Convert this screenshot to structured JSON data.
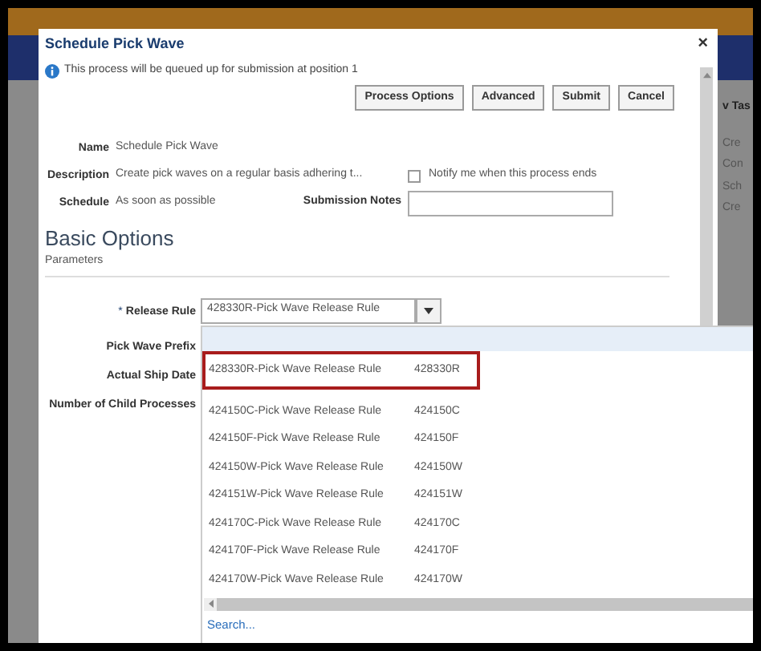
{
  "page_behind": {
    "panel_title": "v Tas",
    "links": [
      "Cre",
      "Con",
      "Sch",
      "Cre"
    ]
  },
  "dialog": {
    "title": "Schedule Pick Wave",
    "close": "×",
    "info": "This process will be queued up for submission at position 1",
    "buttons": [
      "Process Options",
      "Advanced",
      "Submit",
      "Cancel"
    ],
    "name": {
      "label": "Name",
      "value": "Schedule Pick Wave"
    },
    "description": {
      "label": "Description",
      "value": "Create pick waves on a regular basis adhering t..."
    },
    "notify": {
      "label": "Notify me when this process ends",
      "checked": false
    },
    "schedule": {
      "label": "Schedule",
      "value": "As soon as possible"
    },
    "submission_notes": {
      "label": "Submission Notes"
    },
    "section_title": "Basic Options",
    "subsection": "Parameters",
    "parameters": [
      {
        "label": "Release Rule",
        "required_mark": "*",
        "value": "428330R-Pick Wave Release Rule"
      },
      {
        "label": "Pick Wave Prefix"
      },
      {
        "label": "Actual Ship Date"
      },
      {
        "label": "Number of Child Processes"
      }
    ],
    "dropdown": {
      "blank_row_highlighted": true,
      "options": [
        {
          "name": "428330R-Pick Wave Release Rule",
          "code": "428330R",
          "selected": true
        },
        {
          "name": "424150C-Pick Wave Release Rule",
          "code": "424150C",
          "selected": false
        },
        {
          "name": "424150F-Pick Wave Release Rule",
          "code": "424150F",
          "selected": false
        },
        {
          "name": "424150W-Pick Wave Release Rule",
          "code": "424150W",
          "selected": false
        },
        {
          "name": "424151W-Pick Wave Release Rule",
          "code": "424151W",
          "selected": false
        },
        {
          "name": "424170C-Pick Wave Release Rule",
          "code": "424170C",
          "selected": false
        },
        {
          "name": "424170F-Pick Wave Release Rule",
          "code": "424170F",
          "selected": false
        },
        {
          "name": "424170W-Pick Wave Release Rule",
          "code": "424170W",
          "selected": false
        }
      ],
      "search_link": "Search..."
    }
  }
}
